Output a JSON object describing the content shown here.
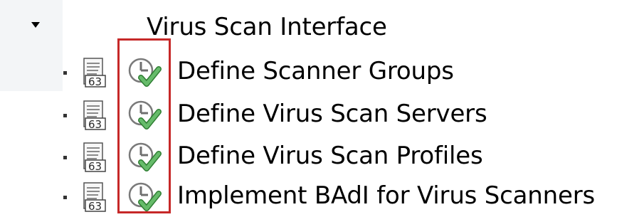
{
  "tree": {
    "root": {
      "label": "Virus Scan Interface",
      "expanded": true,
      "icon": "triangle-down-icon"
    },
    "items": [
      {
        "label": "Define Scanner Groups",
        "doc_icon": "document-icon",
        "activity_icon": "clock-check-icon"
      },
      {
        "label": "Define Virus Scan Servers",
        "doc_icon": "document-icon",
        "activity_icon": "clock-check-icon"
      },
      {
        "label": "Define Virus Scan Profiles",
        "doc_icon": "document-icon",
        "activity_icon": "clock-check-icon"
      },
      {
        "label": "Implement BAdI for Virus Scanners",
        "doc_icon": "document-icon",
        "activity_icon": "clock-check-icon"
      }
    ]
  },
  "highlight": {
    "color": "#c62828"
  },
  "colors": {
    "text": "#000000",
    "check_green": "#4caf50",
    "clock_gray": "#9e9e9e",
    "sidebar_shade": "#f3f5f7"
  }
}
